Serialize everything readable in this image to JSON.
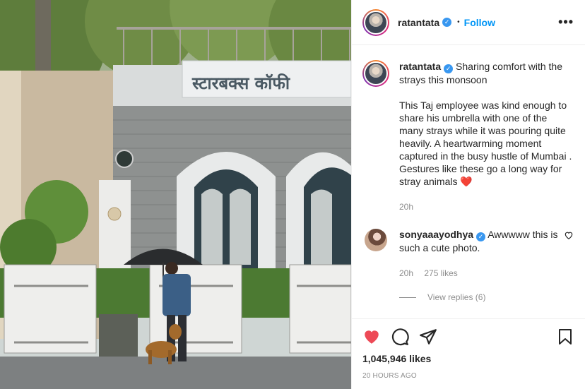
{
  "photo": {
    "sign_text": "स्टारबक्स कॉफी"
  },
  "header": {
    "username": "ratantata",
    "verified_symbol": "✓",
    "separator": "•",
    "follow_label": "Follow",
    "more_icon": "more-options-icon",
    "more_symbol": "•••"
  },
  "caption": {
    "username": "ratantata",
    "line1": "Sharing comfort with the strays this monsoon",
    "line2": "This Taj employee was kind enough to share his umbrella with one of the many strays while it was pouring quite heavily. A heartwarming moment captured in the busy hustle of Mumbai . Gestures like these go a long way for stray animals",
    "emoji": "❤️",
    "time": "20h"
  },
  "comment": {
    "username": "sonyaaayodhya",
    "text": "Awwwww this is such a cute photo.",
    "time": "20h",
    "likes": "275 likes",
    "view_replies": "View replies (6)"
  },
  "actions": {
    "like_icon": "heart-filled-icon",
    "comment_icon": "comment-icon",
    "share_icon": "share-icon",
    "save_icon": "bookmark-icon",
    "like_color": "#ed4956",
    "likes_count": "1,045,946 likes",
    "posted": "20 HOURS AGO"
  },
  "colors": {
    "accent": "#0095f6",
    "verified": "#3897f0",
    "muted": "#8e8e8e",
    "border": "#efefef"
  }
}
